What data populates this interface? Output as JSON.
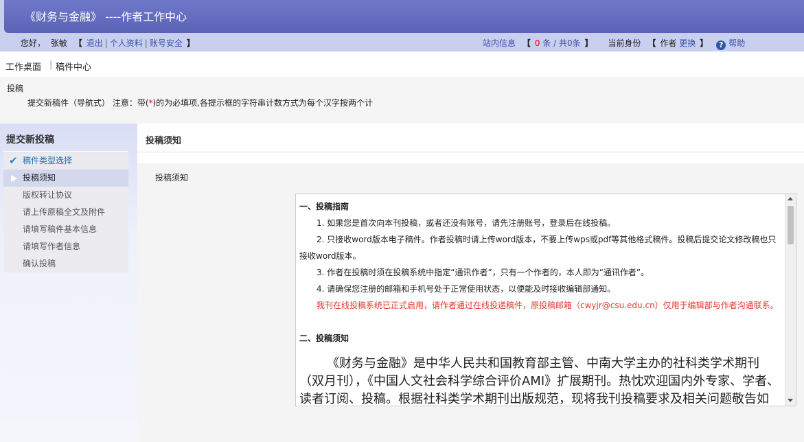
{
  "header": {
    "title": "《财务与金融》 ----作者工作中心"
  },
  "userbar": {
    "greeting": "您好，",
    "username": "张敏",
    "logout": "退出",
    "profile": "个人资料",
    "security": "账号安全",
    "site_msg_label": "站内信息",
    "msg_unread": "0",
    "msg_unread_suffix": "条 / 共0条",
    "identity_label": "当前身份",
    "identity_value": "作者",
    "change": "更换",
    "help": "帮助"
  },
  "nav": {
    "desk": "工作桌面",
    "center": "稿件中心"
  },
  "info": {
    "heading": "投稿",
    "desc_prefix": "提交新稿件（导航式） 注意：带(",
    "desc_star": "*",
    "desc_suffix": ")的为必填项,各提示框的字符串计数方式为每个汉字按两个计"
  },
  "sidebar": {
    "title": "提交新投稿",
    "steps": [
      "稿件类型选择",
      "投稿须知",
      "版权转让协议",
      "请上传原稿全文及附件",
      "请填写稿件基本信息",
      "请填写作者信息",
      "确认投稿"
    ]
  },
  "main": {
    "header": "投稿须知",
    "label": "投稿须知",
    "notice": {
      "sec1": "一、投稿指南",
      "p1": "1. 如果您是首次向本刊投稿，或者还没有账号，请先注册账号，登录后在线投稿。",
      "p2a": "2. 只接收word版本电子稿件。作者投稿时请上传word版本，不要上传wps或pdf等其他格式稿件。投稿后提交论文修改稿也只",
      "p2b": "接收word版本。",
      "p3": "3. 作者在投稿时须在投稿系统中指定“通讯作者”，只有一个作者的，本人即为“通讯作者”。",
      "p4": "4. 请确保您注册的邮箱和手机号处于正常使用状态，以便能及时接收编辑部通知。",
      "red": "我刊在线投稿系统已正式启用，请作者通过在线投递稿件，原投稿邮箱（cwyjr@csu.edu.cn）仅用于编辑部与作者沟通联系。",
      "sec2": "二、投稿须知",
      "big": "《财务与金融》是中华人民共和国教育部主管、中南大学主办的社科类学术期刊（双月刊），《中国人文社会科学综合评价AMI》扩展期刊。热忱欢迎国内外专家、学者、读者订阅、投稿。根据社科类学术期刊出版规范，现将我刊投稿要求及相关问题敬告如下"
    }
  },
  "colors": {
    "banner": "#5a63b6",
    "userbar": "#c9cfef",
    "link": "#3a52a8",
    "alert": "#e0392b"
  }
}
